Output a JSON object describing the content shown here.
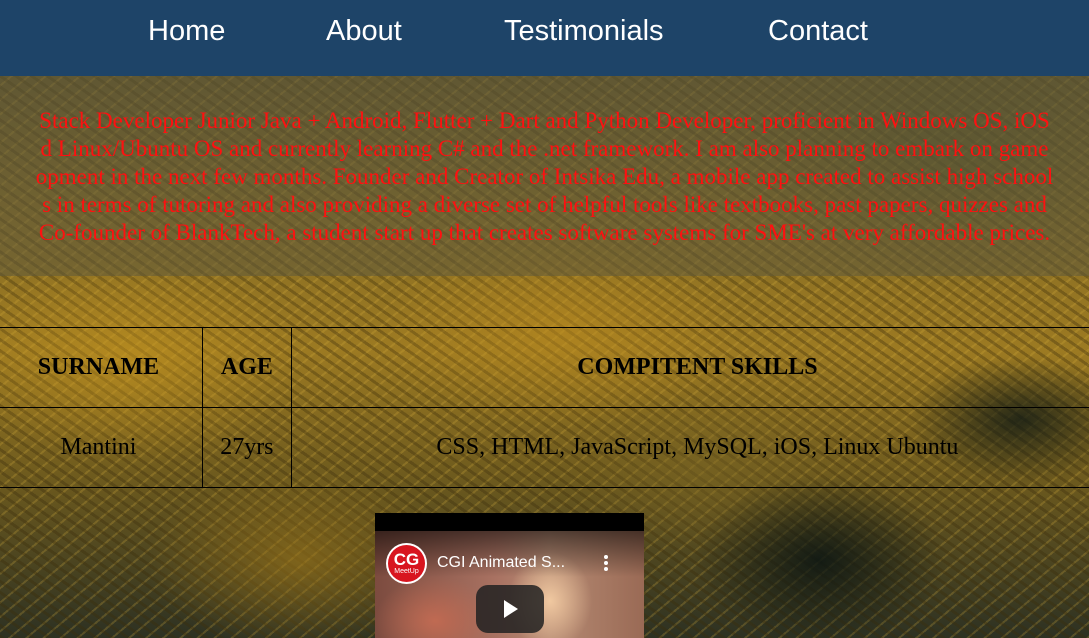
{
  "nav": {
    "items": [
      {
        "label": "Home"
      },
      {
        "label": "About"
      },
      {
        "label": "Testimonials"
      },
      {
        "label": "Contact"
      }
    ]
  },
  "intro": {
    "lines": [
      "Stack Developer Junior Java + Android, Flutter + Dart and Python Developer, proficient in Windows OS, iOS",
      "d Linux/Ubuntu OS and currently learning C# and the .net framework. I am also planning to embark on game",
      "opment in the next few months. Founder and Creator of Intsika Edu, a mobile app created to assist high school",
      "s in terms of tutoring and also providing a diverse set of helpful tools like textbooks, past papers, quizzes and",
      "Co-founder of BlankTech, a student start up that creates software systems for SME's at very affordable prices."
    ],
    "color": "#ff1010"
  },
  "table": {
    "headers": [
      "SURNAME",
      "AGE",
      "COMPITENT SKILLS"
    ],
    "row": [
      "Mantini",
      "27yrs",
      "CSS, HTML, JavaScript, MySQL, iOS, Linux Ubuntu"
    ]
  },
  "video": {
    "title": "CGI Animated S...",
    "channel_logo_text": "CG",
    "channel_logo_subtext": "MeetUp",
    "brand_color": "#d8151f"
  },
  "colors": {
    "navbar": "#1e4468",
    "nav_text": "#ffffff"
  }
}
